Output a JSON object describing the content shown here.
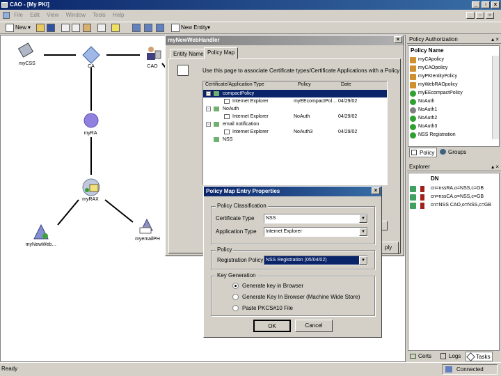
{
  "window": {
    "title": "CAO - [My PKI]"
  },
  "menu": [
    "File",
    "Edit",
    "View",
    "Window",
    "Tools",
    "Help"
  ],
  "toolbar": {
    "new_label": "New",
    "new_entity_label": "New Entity"
  },
  "graph": {
    "nodes": {
      "mycss": "myCSS",
      "ca": "CA",
      "cao": "CAO",
      "myra": "myRA",
      "myrax": "myRAX",
      "mynewweb": "myNewWeb…",
      "myemailph": "myemailPH"
    }
  },
  "handler_dialog": {
    "title": "myNewWebHandler",
    "tabs": [
      "Entity Name",
      "Policy Map"
    ],
    "description": "Use this page to associate Certificate types/Certificate Applications with a Policy",
    "columns": [
      "Certificate/Application Type",
      "Policy",
      "Date"
    ],
    "rows": [
      {
        "name": "compactPolicy",
        "policy": "",
        "date": ""
      },
      {
        "name": "Internet Explorer",
        "policy": "myEEcompactPol…",
        "date": "04/29/02"
      },
      {
        "name": "NoAuth",
        "policy": "",
        "date": ""
      },
      {
        "name": "Internet Explorer",
        "policy": "NoAuth",
        "date": "04/29/02"
      },
      {
        "name": "email notification",
        "policy": "",
        "date": ""
      },
      {
        "name": "Internet Explorer",
        "policy": "NoAuth3",
        "date": "04/29/02"
      },
      {
        "name": "NSS",
        "policy": "",
        "date": ""
      }
    ],
    "apply_label": "ply"
  },
  "entry_dialog": {
    "title": "Policy Map Entry Properties",
    "classification_label": "Policy Classification",
    "cert_type_label": "Certificate Type",
    "cert_type_value": "NSS",
    "app_type_label": "Application Type",
    "app_type_value": "Internet Explorer",
    "policy_group_label": "Policy",
    "reg_policy_label": "Registration Policy",
    "reg_policy_value": "NSS Registration (05/04/02)",
    "keygen_label": "Key Generation",
    "options": [
      "Generate key in Browser",
      "Generate Key In Browser (Machine Wide Store)",
      "Paste PKCS#10 File"
    ],
    "ok_label": "OK",
    "cancel_label": "Cancel"
  },
  "policy_panel": {
    "title": "Policy Authorization",
    "column": "Policy Name",
    "items": [
      "myCApolicy",
      "myCAOpolicy",
      "myPKIentityPolicy",
      "myWebRAOpolicy",
      "myEEcompactPolicy",
      "NoAuth",
      "NoAuth1",
      "NoAuth2",
      "NoAuth3",
      "NSS Registration"
    ],
    "tabs": [
      "Policy",
      "Groups"
    ]
  },
  "explorer_panel": {
    "title": "Explorer",
    "column": "DN",
    "rows": [
      "cn=nssRA,o=NSS,c=GB",
      "cn=nssCA,o=NSS,c=GB",
      "cn=NSS CAO,o=NSS,c=GB"
    ]
  },
  "bottom_tabs": [
    "Certs",
    "Logs",
    "Tasks"
  ],
  "status": {
    "left": "Ready",
    "right": "Connected"
  }
}
